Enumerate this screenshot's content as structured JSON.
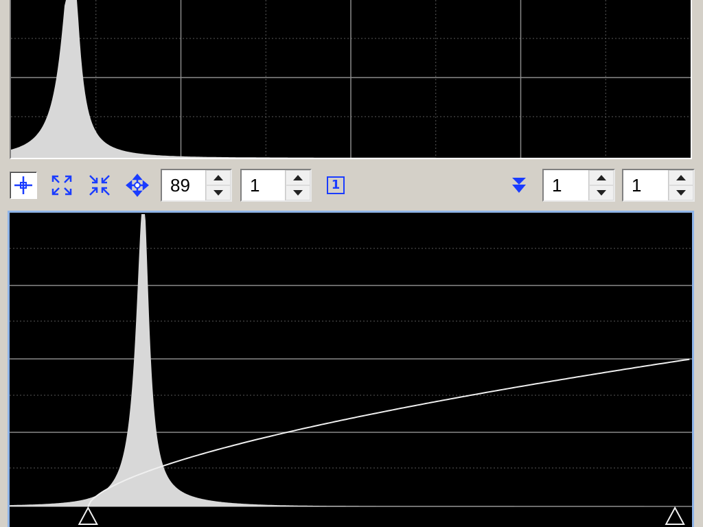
{
  "toolbar": {
    "buttons_left": [
      {
        "name": "crosshair-mode-button",
        "icon": "crosshair-icon",
        "pressed": true
      },
      {
        "name": "zoom-to-fit-button",
        "icon": "expand-arrows-icon",
        "pressed": false
      },
      {
        "name": "zoom-in-center-button",
        "icon": "compress-arrows-icon",
        "pressed": false
      },
      {
        "name": "pan-button",
        "icon": "move-arrows-icon",
        "pressed": false
      }
    ],
    "spin_zoom_x": "89",
    "spin_zoom_y": "1",
    "one_to_one_label": "1",
    "collapse_icon": "double-chevron-down-icon",
    "spin_right_1": "1",
    "spin_right_2": "1"
  },
  "colors": {
    "panel_bg": "#000000",
    "histogram_fill": "#d8d8d8",
    "grid_major": "#8a8a8a",
    "grid_minor": "#5a5a5a",
    "icon_blue": "#1a3cff",
    "active_border": "#8fb4e8",
    "window_bg": "#d4d0c8"
  },
  "chart_data": [
    {
      "type": "area",
      "name": "histogram-overview",
      "peak_position": 0.09,
      "grid": true
    },
    {
      "type": "area",
      "name": "histogram-zoomed",
      "peak_position": 0.196,
      "curve": "midtones-transfer-function",
      "shadows_clip": 0.115,
      "highlights_clip": 0.975,
      "grid": true
    }
  ]
}
